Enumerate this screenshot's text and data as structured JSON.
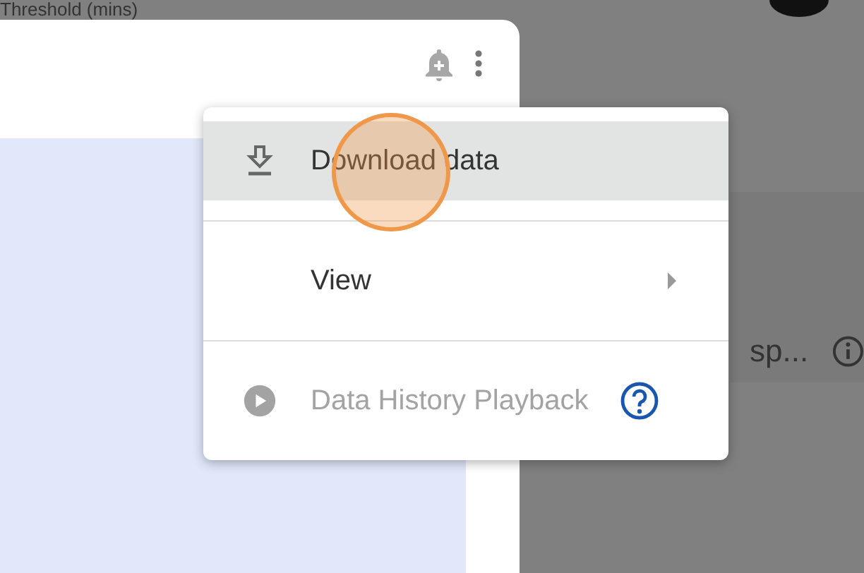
{
  "header_label": "Threshold (mins)",
  "menu": {
    "items": [
      {
        "kind": "download",
        "label": "Download data",
        "highlighted": true,
        "disabled": false
      },
      {
        "kind": "submenu",
        "label": "View",
        "highlighted": false,
        "disabled": false
      },
      {
        "kind": "playback",
        "label": "Data History Playback",
        "highlighted": false,
        "disabled": true
      }
    ]
  },
  "side_card": {
    "text": "sp..."
  }
}
